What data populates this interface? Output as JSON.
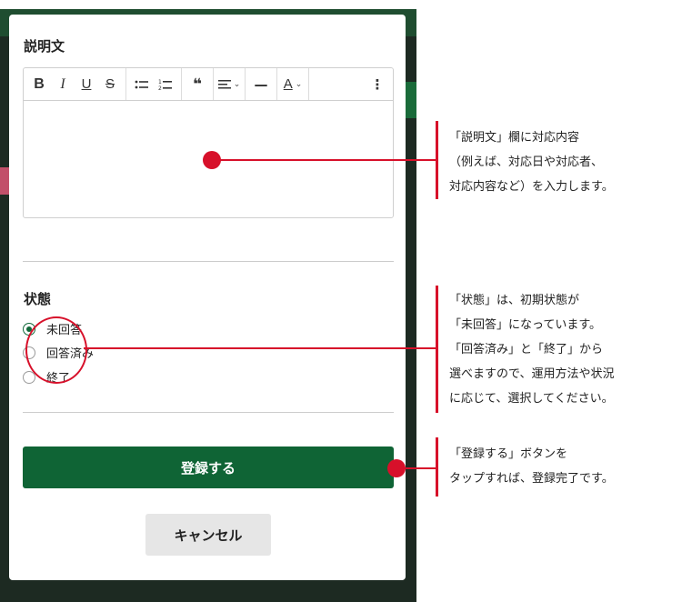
{
  "description_section": {
    "title": "説明文"
  },
  "toolbar": {
    "bold": "B",
    "italic": "I",
    "underline": "U",
    "strikethrough": "S",
    "bullet_list_icon": "bullet-list-icon",
    "numbered_list_icon": "numbered-list-icon",
    "quote": "❝",
    "align_icon": "align-icon",
    "rule": "—",
    "text_color": "A",
    "more_icon": "more-vertical-icon"
  },
  "status_section": {
    "title": "状態",
    "options": [
      {
        "label": "未回答",
        "selected": true
      },
      {
        "label": "回答済み",
        "selected": false
      },
      {
        "label": "終了",
        "selected": false
      }
    ]
  },
  "buttons": {
    "register": "登録する",
    "cancel": "キャンセル"
  },
  "annotations": {
    "description": "「説明文」欄に対応内容\n（例えば、対応日や対応者、\n 対応内容など）を入力します。",
    "status": "「状態」は、初期状態が\n「未回答」になっています。\n「回答済み」と「終了」から\n 選べますので、運用方法や状況\n に応じて、選択してください。",
    "register": "「登録する」ボタンを\n タップすれば、登録完了です。"
  },
  "colors": {
    "accent": "#0f6435",
    "annotation": "#d7102a"
  }
}
